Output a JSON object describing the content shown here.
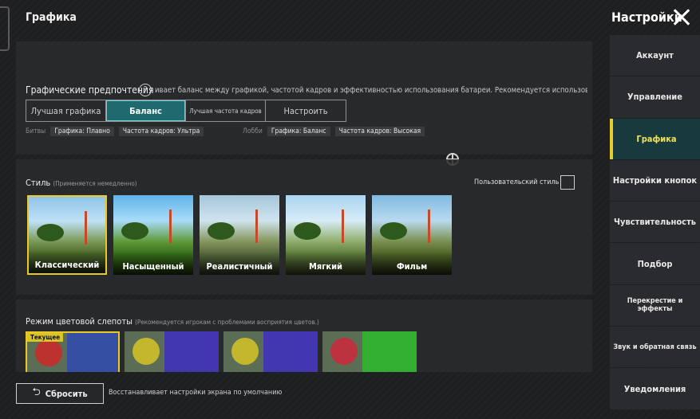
{
  "header": {
    "page_title": "Графика",
    "settings_title": "Настройки"
  },
  "sidebar": {
    "items": [
      {
        "label": "Аккаунт"
      },
      {
        "label": "Управление"
      },
      {
        "label": "Графика"
      },
      {
        "label": "Настройки кнопок"
      },
      {
        "label": "Чувствительность"
      },
      {
        "label": "Подбор"
      },
      {
        "label": "Перекрестие и эффекты"
      },
      {
        "label": "Звук и обратная связь"
      },
      {
        "label": "Уведомления"
      }
    ],
    "active_index": 2
  },
  "preferences": {
    "label": "Графические предпочтения",
    "help_glyph": "?",
    "description": "ивает баланс между графикой, частотой кадров и эффективностью использования батареи. Рекомендуется использовать, если",
    "options": [
      "Лучшая графика",
      "Баланс",
      "Лучшая частота кадров",
      "Настроить"
    ],
    "selected": "Баланс",
    "battles_label": "Битвы",
    "battles_tags": [
      "Графика: Плавно",
      "Частота кадров: Ультра"
    ],
    "lobby_label": "Лобби",
    "lobby_tags": [
      "Графика: Баланс",
      "Частота кадров: Высокая"
    ]
  },
  "style": {
    "title": "Стиль",
    "subtitle": "(Применяется немедленно)",
    "custom_label": "Пользовательский стиль",
    "custom_checked": false,
    "options": [
      "Классический",
      "Насыщенный",
      "Реалистичный",
      "Мягкий",
      "Фильм"
    ],
    "selected": "Классический"
  },
  "color_blind": {
    "title": "Режим цветовой слепоты",
    "subtitle": "(Рекомендуется игрокам с проблемами восприятия цветов.)",
    "current_badge": "Текущее"
  },
  "footer": {
    "reset_label": "Сбросить",
    "reset_icon_glyph": "⮌",
    "reset_description": "Восстанавливает настройки экрана по умолчанию"
  },
  "colors": {
    "accent_yellow": "#e9c92a",
    "active_teal": "#1f6a6e"
  }
}
